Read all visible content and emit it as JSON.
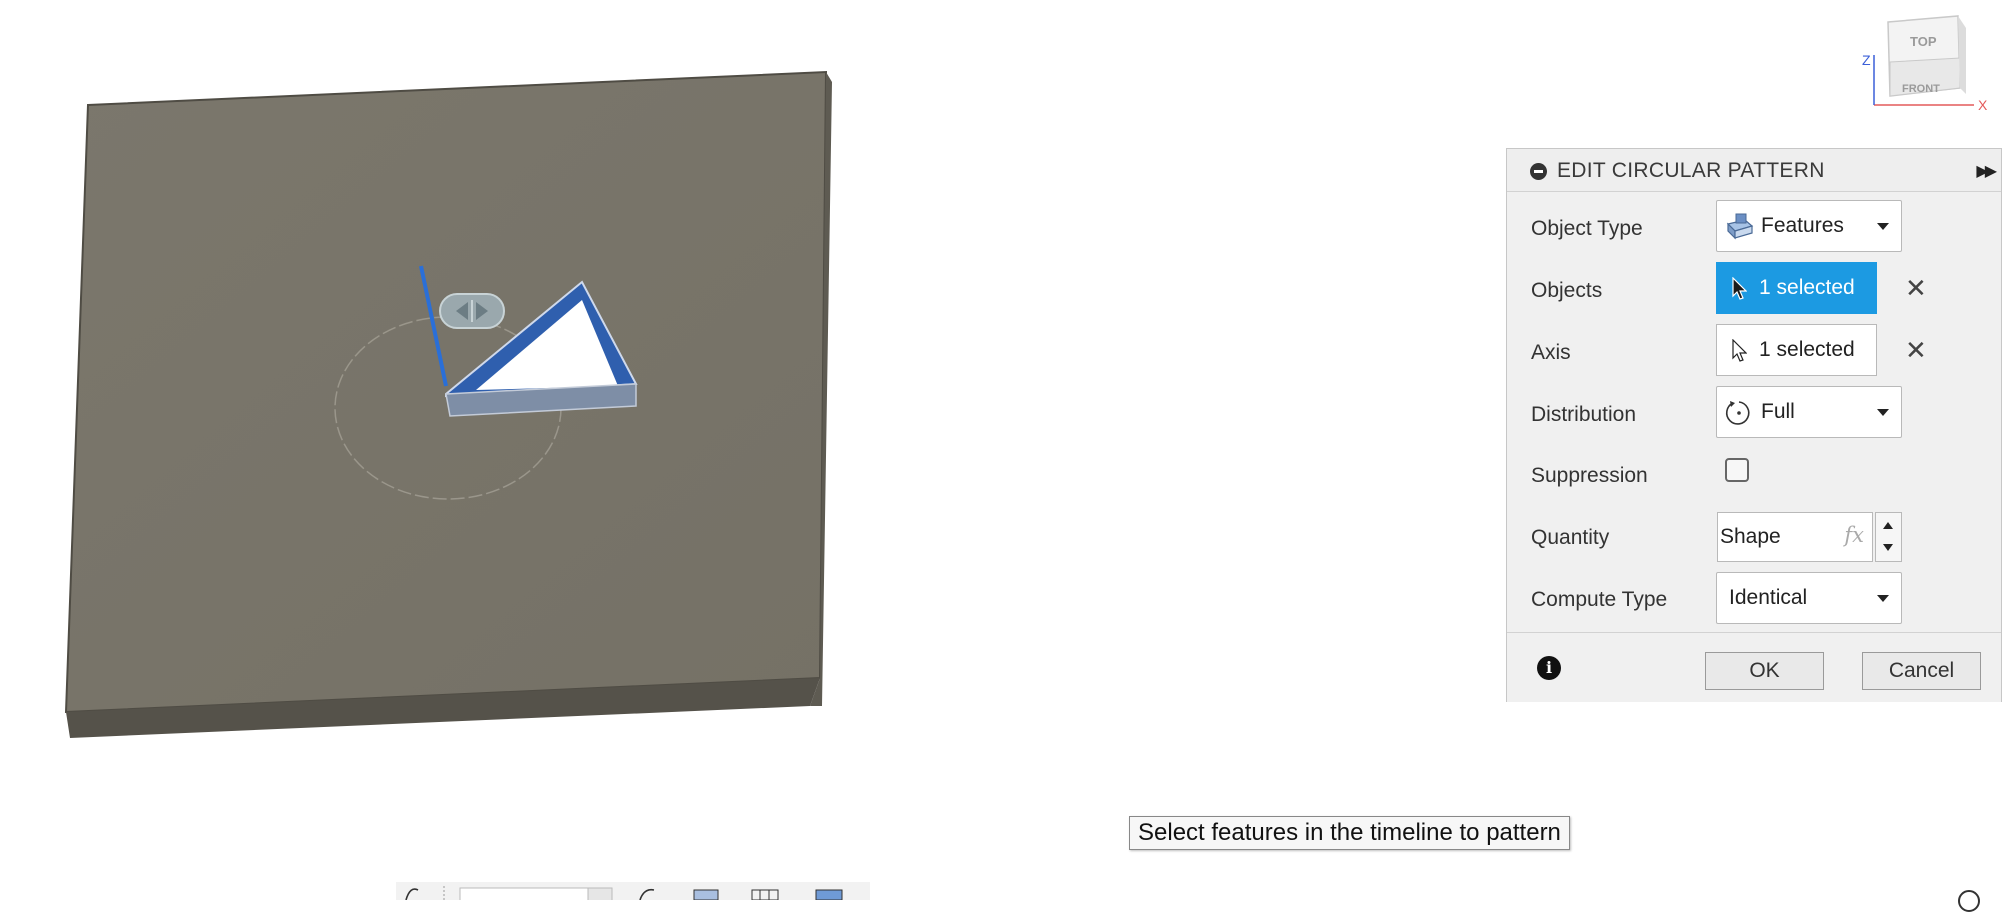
{
  "viewcube": {
    "top_label": "TOP",
    "front_label": "FRONT",
    "z_axis_label": "Z",
    "x_axis_label": "X"
  },
  "dialog": {
    "title": "EDIT CIRCULAR PATTERN",
    "rows": {
      "object_type": {
        "label": "Object Type",
        "value": "Features"
      },
      "objects": {
        "label": "Objects",
        "value": "1 selected"
      },
      "axis": {
        "label": "Axis",
        "value": "1 selected"
      },
      "distribution": {
        "label": "Distribution",
        "value": "Full"
      },
      "suppression": {
        "label": "Suppression",
        "checked": false
      },
      "quantity": {
        "label": "Quantity",
        "value": "Shape",
        "fx": "fx"
      },
      "compute_type": {
        "label": "Compute Type",
        "value": "Identical"
      }
    },
    "footer": {
      "ok_label": "OK",
      "cancel_label": "Cancel",
      "info_glyph": "i"
    }
  },
  "tooltip": {
    "text": "Select features in the timeline to pattern"
  },
  "colors": {
    "accent": "#1c9ae2",
    "plate": "#7a766a",
    "feature_blue": "#2f5fae",
    "axis_blue": "#2a6fd8"
  },
  "icons": {
    "collapse": "collapse-icon",
    "expand": "double-chevron-right-icon",
    "features": "features-cube-icon",
    "select_arrow": "cursor-arrow-icon",
    "distribution": "circular-distribution-icon",
    "info": "info-icon",
    "clear": "close-icon"
  }
}
